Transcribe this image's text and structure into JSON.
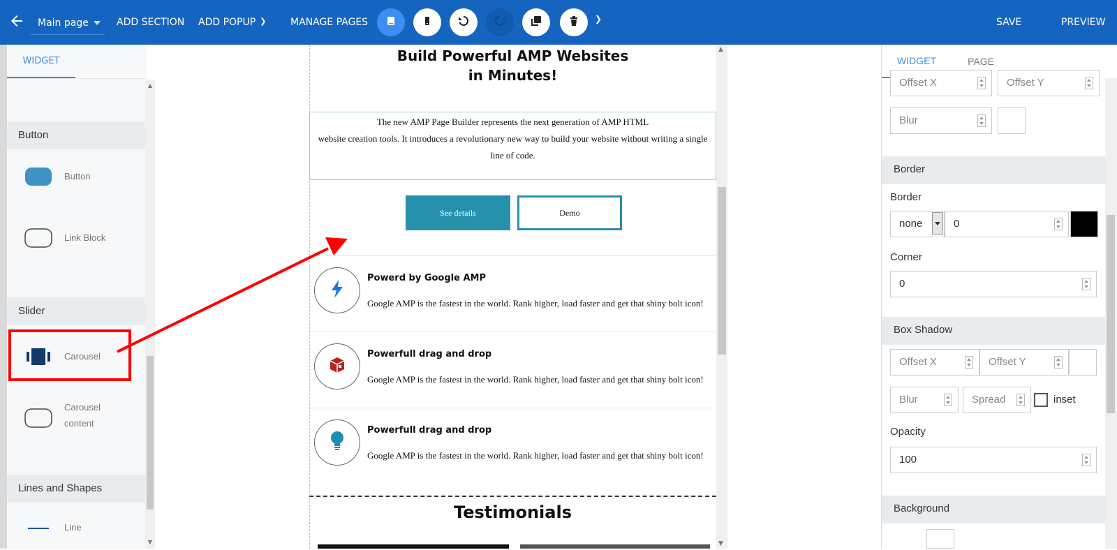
{
  "toolbar": {
    "page_select": "Main page",
    "add_section": "ADD SECTION",
    "add_popup": "ADD POPUP",
    "manage_pages": "MANAGE PAGES",
    "save": "SAVE",
    "preview": "PREVIEW",
    "icons": [
      "back-arrow-icon",
      "desktop-view-icon",
      "mobile-view-icon",
      "undo-icon",
      "redo-icon",
      "duplicate-icon",
      "delete-icon",
      "chevron-down-icon"
    ],
    "colors": {
      "bar": "#1565c0",
      "active": "#3d8ef0"
    }
  },
  "left_panel": {
    "tab": "WIDGET",
    "categories": [
      {
        "title": "Button",
        "items": [
          "Button",
          "Link Block"
        ]
      },
      {
        "title": "Slider",
        "items": [
          "Carousel",
          "Carousel content"
        ]
      },
      {
        "title": "Lines and Shapes",
        "items": [
          "Line"
        ]
      }
    ],
    "carousel_label": "Carousel",
    "carousel_content_l1": "Carousel",
    "carousel_content_l2": "content"
  },
  "canvas": {
    "headline_l1": "Build Powerful AMP Websites",
    "headline_l2": "in Minutes!",
    "intro_l1": "The new AMP Page Builder represents the next generation of AMP HTML",
    "intro_l2": "website creation tools. It introduces a revolutionary new way to build your website without writing a single",
    "intro_l3": "line of code.",
    "btn_details": "See details",
    "btn_demo": "Demo",
    "features": [
      {
        "title": "Powerd by Google AMP",
        "desc": "Google AMP is the fastest in the world. Rank higher, load faster and get that shiny bolt icon!",
        "icon": "bolt-icon"
      },
      {
        "title": "Powerfull drag and drop",
        "desc": "Google AMP is the fastest in the world. Rank higher, load faster and get that shiny bolt icon!",
        "icon": "cube-icon"
      },
      {
        "title": "Powerfull drag and drop",
        "desc": "Google AMP is the fastest in the world. Rank higher, load faster and get that shiny bolt icon!",
        "icon": "lightbulb-icon"
      }
    ],
    "testimonials": "Testimonials"
  },
  "right_panel": {
    "tab_widget": "WIDGET",
    "tab_page": "PAGE",
    "top_shadow": {
      "offset_x": "Offset X",
      "offset_y": "Offset Y",
      "blur": "Blur"
    },
    "border_section": "Border",
    "border_label": "Border",
    "border_style": "none",
    "border_width": "0",
    "border_color": "#000000",
    "corner_label": "Corner",
    "corner_value": "0",
    "box_shadow_section": "Box Shadow",
    "box_shadow": {
      "offset_x": "Offset X",
      "offset_y": "Offset Y",
      "blur": "Blur",
      "spread": "Spread",
      "inset": "inset"
    },
    "opacity_label": "Opacity",
    "opacity_value": "100",
    "background_section": "Background"
  }
}
